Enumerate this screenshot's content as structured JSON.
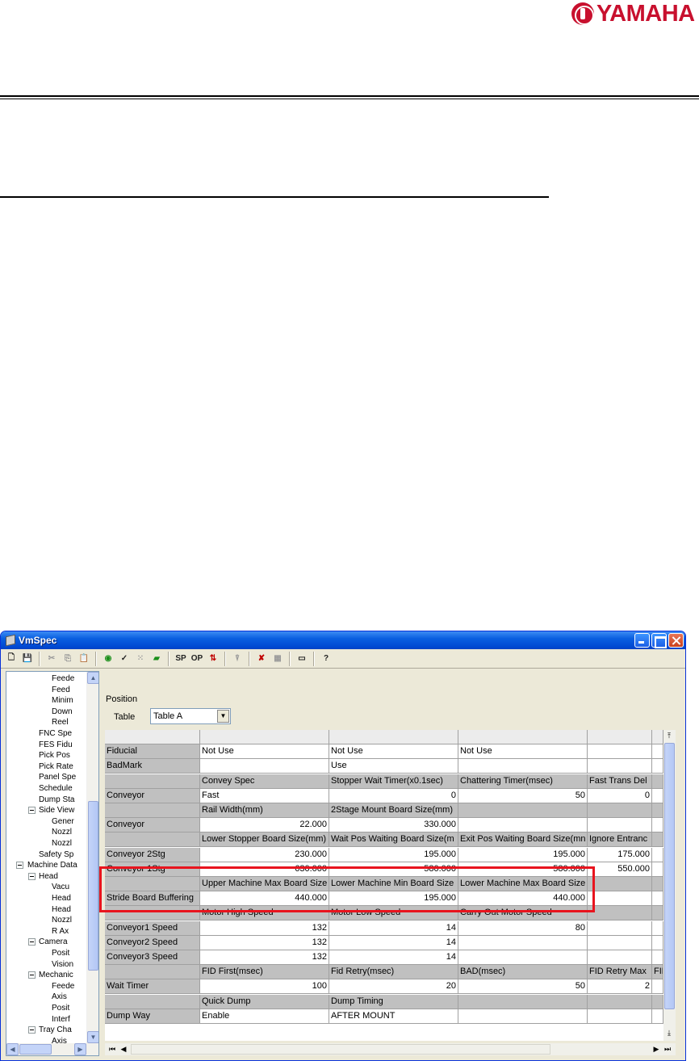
{
  "brand": {
    "logo_text": "YAMAHA"
  },
  "window": {
    "title": "VmSpec",
    "toolbar": [
      {
        "name": "new-icon",
        "glyph": "🗋"
      },
      {
        "name": "save-icon",
        "glyph": "💾"
      },
      {
        "name": "cut-icon",
        "glyph": "✂"
      },
      {
        "name": "copy-icon",
        "glyph": "⎘"
      },
      {
        "name": "paste-icon",
        "glyph": "📋"
      },
      {
        "name": "check-disk-icon",
        "glyph": "◉"
      },
      {
        "name": "check-edit-icon",
        "glyph": "✓"
      },
      {
        "name": "dots-icon",
        "glyph": "⁙"
      },
      {
        "name": "board-icon",
        "glyph": "▰"
      },
      {
        "name": "sp-button",
        "glyph": "SP"
      },
      {
        "name": "op-button",
        "glyph": "OP"
      },
      {
        "name": "transfer-icon",
        "glyph": "⇅"
      },
      {
        "name": "nozzle-icon",
        "glyph": "⍒"
      },
      {
        "name": "disconnect-icon",
        "glyph": "✘"
      },
      {
        "name": "grid-icon",
        "glyph": "▦"
      },
      {
        "name": "keyboard-icon",
        "glyph": "▭"
      },
      {
        "name": "help-icon",
        "glyph": "?"
      }
    ]
  },
  "tree": {
    "items": [
      {
        "label": "Feede",
        "level": 3
      },
      {
        "label": "Feed",
        "level": 3
      },
      {
        "label": "Minim",
        "level": 3
      },
      {
        "label": "Down",
        "level": 3
      },
      {
        "label": "Reel",
        "level": 3
      },
      {
        "label": "FNC Spe",
        "level": 2
      },
      {
        "label": "FES Fidu",
        "level": 2
      },
      {
        "label": "Pick Pos",
        "level": 2
      },
      {
        "label": "Pick Rate",
        "level": 2
      },
      {
        "label": "Panel Spe",
        "level": 2
      },
      {
        "label": "Schedule",
        "level": 2
      },
      {
        "label": "Dump Sta",
        "level": 2
      },
      {
        "label": "Side View",
        "level": 2
      },
      {
        "label": "Gener",
        "level": 3
      },
      {
        "label": "Nozzl",
        "level": 3
      },
      {
        "label": "Nozzl",
        "level": 3
      },
      {
        "label": "Safety Sp",
        "level": 2
      },
      {
        "label": "Machine Data",
        "level": 1
      },
      {
        "label": "Head",
        "level": 2
      },
      {
        "label": "Vacu",
        "level": 3
      },
      {
        "label": "Head",
        "level": 3
      },
      {
        "label": "Head",
        "level": 3
      },
      {
        "label": "Nozzl",
        "level": 3
      },
      {
        "label": "R Ax",
        "level": 3
      },
      {
        "label": "Camera",
        "level": 2
      },
      {
        "label": "Posit",
        "level": 3
      },
      {
        "label": "Vision",
        "level": 3
      },
      {
        "label": "Mechanic",
        "level": 2
      },
      {
        "label": "Feede",
        "level": 3
      },
      {
        "label": "Axis",
        "level": 3
      },
      {
        "label": "Posit",
        "level": 3
      },
      {
        "label": "Interf",
        "level": 3
      },
      {
        "label": "Tray Cha",
        "level": 2
      },
      {
        "label": "Axis",
        "level": 3
      }
    ]
  },
  "panel": {
    "section_title": "Position",
    "table_label": "Table",
    "table_select": "Table A"
  },
  "grid": {
    "rows": [
      {
        "type": "hdr",
        "cells": [
          "",
          "",
          "",
          "",
          "",
          ""
        ],
        "strip": true
      },
      {
        "type": "val",
        "cells": [
          "Fiducial",
          "Not Use",
          "Not Use",
          "Not Use",
          "",
          ""
        ]
      },
      {
        "type": "val",
        "cells": [
          "BadMark",
          "",
          "Use",
          "",
          "",
          ""
        ]
      },
      {
        "type": "hdr",
        "cells": [
          "",
          "Convey Spec",
          "Stopper Wait Timer(x0.1sec)",
          "Chattering Timer(msec)",
          "Fast Trans Del",
          ""
        ]
      },
      {
        "type": "val",
        "cells": [
          "Conveyor",
          "Fast",
          "0",
          "50",
          "0",
          ""
        ],
        "num": [
          false,
          false,
          true,
          true,
          true,
          false
        ]
      },
      {
        "type": "hdr",
        "cells": [
          "",
          "Rail Width(mm)",
          "2Stage Mount Board Size(mm)",
          "",
          "",
          ""
        ]
      },
      {
        "type": "val",
        "cells": [
          "Conveyor",
          "22.000",
          "330.000",
          "",
          "",
          ""
        ],
        "num": [
          false,
          true,
          true,
          false,
          false,
          false
        ]
      },
      {
        "type": "hdr",
        "cells": [
          "",
          "Lower Stopper Board Size(mm)",
          "Wait Pos Waiting Board Size(m",
          "Exit Pos Waiting Board Size(mn",
          "Ignore Entranc",
          ""
        ]
      },
      {
        "type": "val",
        "cells": [
          "Conveyor 2Stg",
          "230.000",
          "195.000",
          "195.000",
          "175.000",
          ""
        ],
        "num": [
          false,
          true,
          true,
          true,
          true,
          false
        ]
      },
      {
        "type": "val",
        "cells": [
          "Conveyor 1Stg",
          "630.000",
          "580.000",
          "580.000",
          "550.000",
          ""
        ],
        "num": [
          false,
          true,
          true,
          true,
          true,
          false
        ]
      },
      {
        "type": "hdr",
        "cells": [
          "",
          "Upper Machine Max Board Size",
          "Lower Machine Min Board Size",
          "Lower Machine Max Board Size",
          "",
          ""
        ]
      },
      {
        "type": "val",
        "cells": [
          "Stride Board Buffering",
          "440.000",
          "195.000",
          "440.000",
          "",
          ""
        ],
        "num": [
          false,
          true,
          true,
          true,
          false,
          false
        ]
      },
      {
        "type": "hdr",
        "cells": [
          "",
          "Motor High Speed",
          "Motor Low Speed",
          "Carry Out Motor Speed",
          "",
          ""
        ]
      },
      {
        "type": "val",
        "cells": [
          "Conveyor1 Speed",
          "132",
          "14",
          "80",
          "",
          ""
        ],
        "num": [
          false,
          true,
          true,
          true,
          false,
          false
        ]
      },
      {
        "type": "val",
        "cells": [
          "Conveyor2 Speed",
          "132",
          "14",
          "",
          "",
          ""
        ],
        "num": [
          false,
          true,
          true,
          false,
          false,
          false
        ]
      },
      {
        "type": "val",
        "cells": [
          "Conveyor3 Speed",
          "132",
          "14",
          "",
          "",
          ""
        ],
        "num": [
          false,
          true,
          true,
          false,
          false,
          false
        ]
      },
      {
        "type": "hdr",
        "cells": [
          "",
          "FID First(msec)",
          "Fid Retry(msec)",
          "BAD(msec)",
          "FID Retry Max",
          "FID"
        ]
      },
      {
        "type": "val",
        "cells": [
          "Wait Timer",
          "100",
          "20",
          "50",
          "2",
          ""
        ],
        "num": [
          false,
          true,
          true,
          true,
          true,
          false
        ]
      },
      {
        "type": "hdr",
        "cells": [
          "",
          "Quick Dump",
          "Dump Timing",
          "",
          "",
          ""
        ]
      },
      {
        "type": "val",
        "cells": [
          "Dump Way",
          "Enable",
          "AFTER MOUNT",
          "",
          "",
          ""
        ]
      }
    ]
  },
  "colors": {
    "highlight": "#e8141e",
    "brand": "#c8102e",
    "header_cell": "#c0c0c0"
  }
}
